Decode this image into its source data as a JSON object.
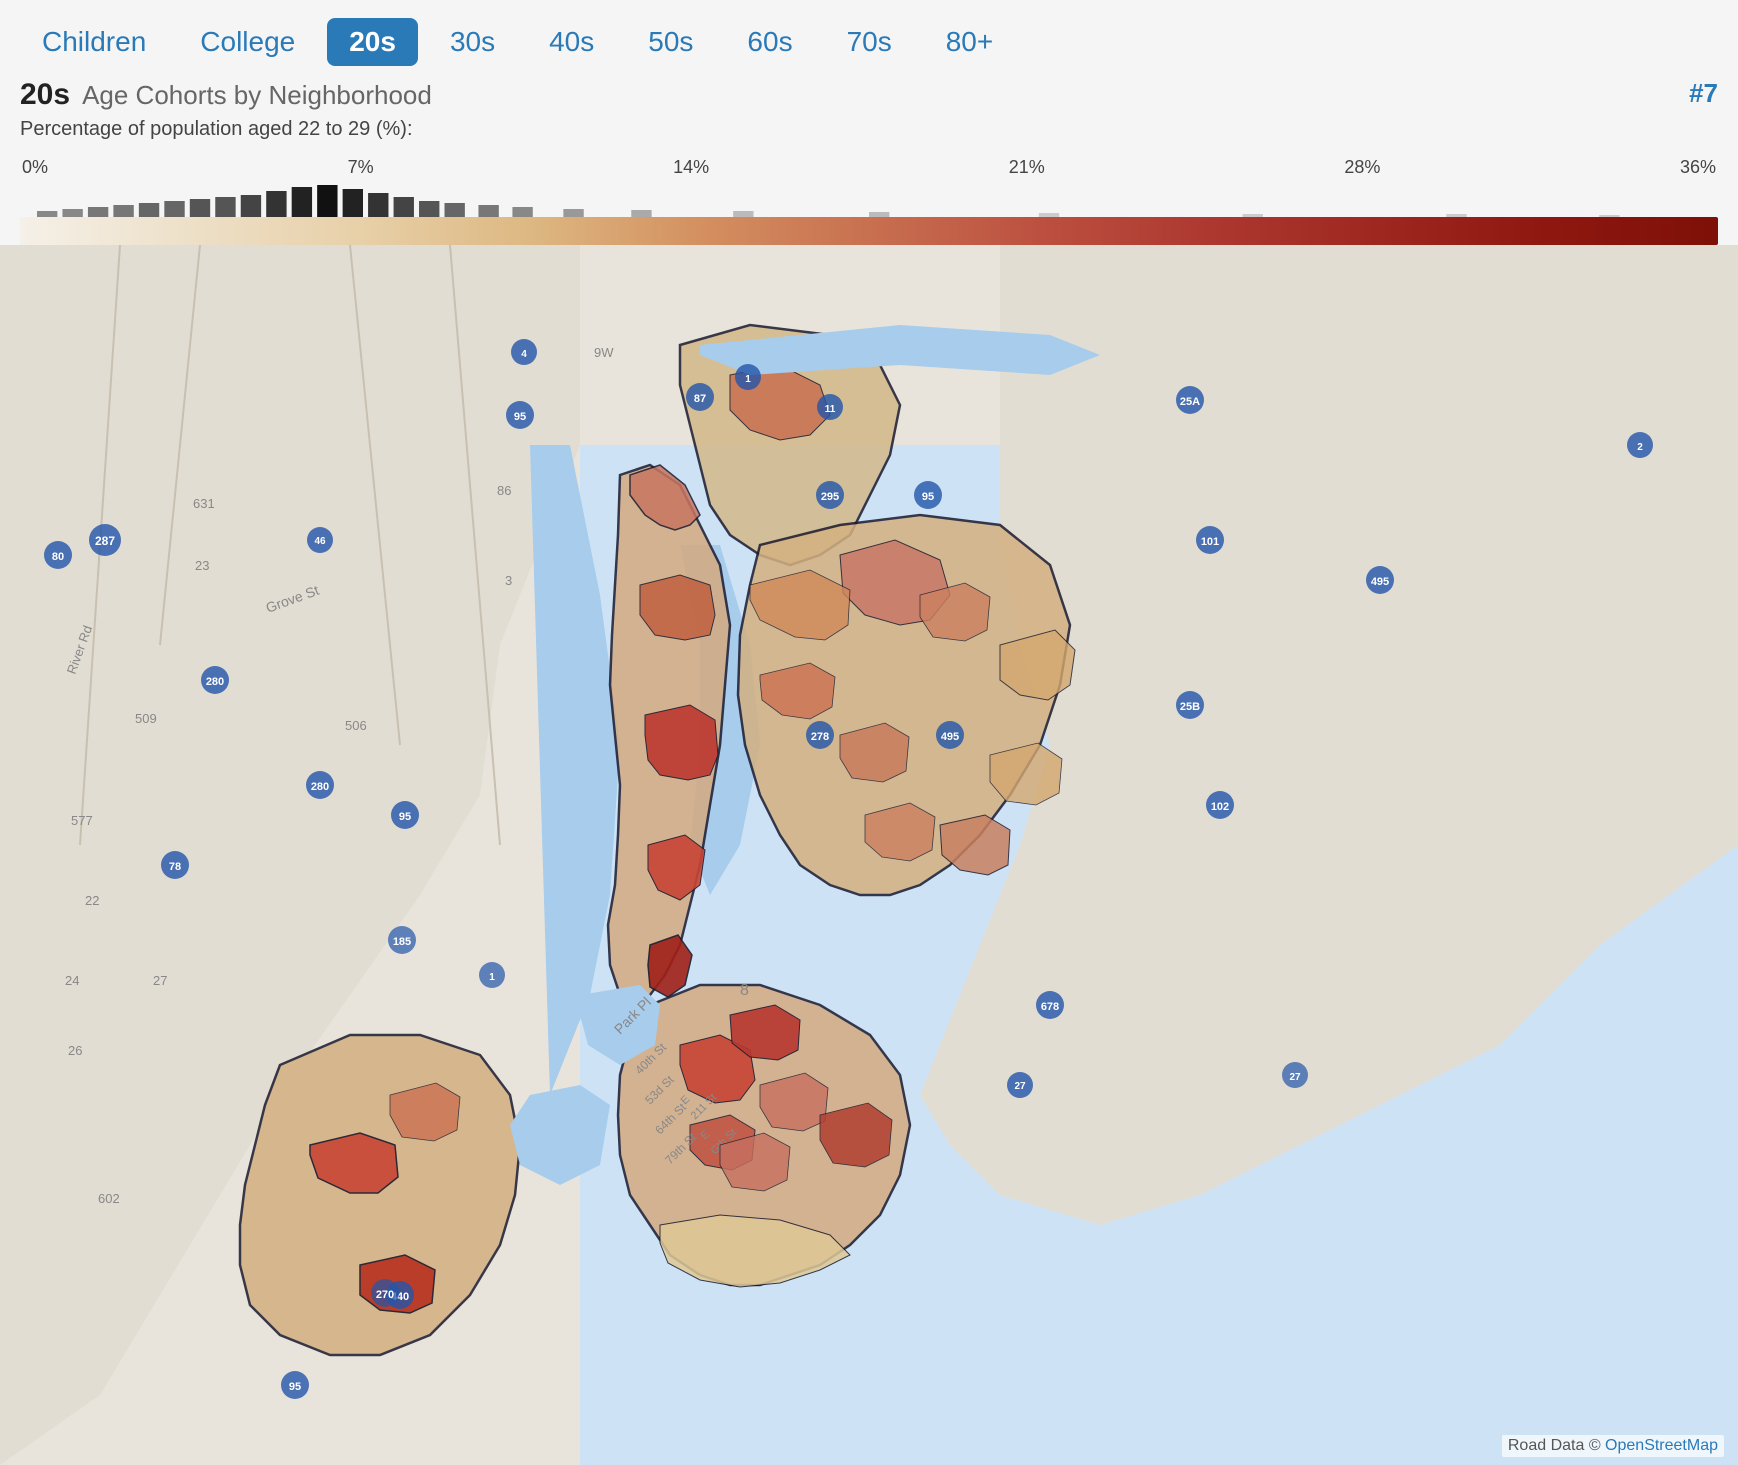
{
  "tabs": [
    {
      "label": "Children",
      "active": false
    },
    {
      "label": "College",
      "active": false
    },
    {
      "label": "20s",
      "active": true
    },
    {
      "label": "30s",
      "active": false
    },
    {
      "label": "40s",
      "active": false
    },
    {
      "label": "50s",
      "active": false
    },
    {
      "label": "60s",
      "active": false
    },
    {
      "label": "70s",
      "active": false
    },
    {
      "label": "80+",
      "active": false
    }
  ],
  "chart": {
    "title_bold": "20s",
    "title_light": "Age Cohorts by Neighborhood",
    "number": "#7",
    "subtitle": "Percentage of population aged 22 to 29 (%):",
    "legend_labels": [
      "0%",
      "7%",
      "14%",
      "21%",
      "28%",
      "36%"
    ]
  },
  "attribution": {
    "text": "Road Data © OpenStreetMap",
    "link_text": "OpenStreetMap"
  }
}
